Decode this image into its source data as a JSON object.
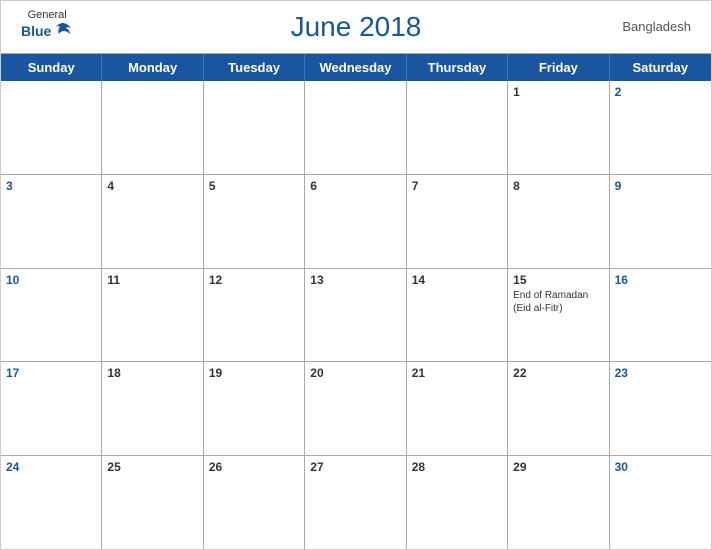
{
  "header": {
    "title": "June 2018",
    "country": "Bangladesh",
    "logo": {
      "general": "General",
      "blue": "Blue"
    }
  },
  "dayHeaders": [
    "Sunday",
    "Monday",
    "Tuesday",
    "Wednesday",
    "Thursday",
    "Friday",
    "Saturday"
  ],
  "weeks": [
    [
      {
        "day": "",
        "weekend": false
      },
      {
        "day": "",
        "weekend": false
      },
      {
        "day": "",
        "weekend": false
      },
      {
        "day": "",
        "weekend": false
      },
      {
        "day": "",
        "weekend": false
      },
      {
        "day": "1",
        "weekend": false
      },
      {
        "day": "2",
        "weekend": true
      }
    ],
    [
      {
        "day": "3",
        "weekend": true
      },
      {
        "day": "4",
        "weekend": false
      },
      {
        "day": "5",
        "weekend": false
      },
      {
        "day": "6",
        "weekend": false
      },
      {
        "day": "7",
        "weekend": false
      },
      {
        "day": "8",
        "weekend": false
      },
      {
        "day": "9",
        "weekend": true
      }
    ],
    [
      {
        "day": "10",
        "weekend": true
      },
      {
        "day": "11",
        "weekend": false
      },
      {
        "day": "12",
        "weekend": false
      },
      {
        "day": "13",
        "weekend": false
      },
      {
        "day": "14",
        "weekend": false
      },
      {
        "day": "15",
        "weekend": false,
        "event": "End of Ramadan (Eid al-Fitr)"
      },
      {
        "day": "16",
        "weekend": true
      }
    ],
    [
      {
        "day": "17",
        "weekend": true
      },
      {
        "day": "18",
        "weekend": false
      },
      {
        "day": "19",
        "weekend": false
      },
      {
        "day": "20",
        "weekend": false
      },
      {
        "day": "21",
        "weekend": false
      },
      {
        "day": "22",
        "weekend": false
      },
      {
        "day": "23",
        "weekend": true
      }
    ],
    [
      {
        "day": "24",
        "weekend": true
      },
      {
        "day": "25",
        "weekend": false
      },
      {
        "day": "26",
        "weekend": false
      },
      {
        "day": "27",
        "weekend": false
      },
      {
        "day": "28",
        "weekend": false
      },
      {
        "day": "29",
        "weekend": false
      },
      {
        "day": "30",
        "weekend": true
      }
    ]
  ]
}
